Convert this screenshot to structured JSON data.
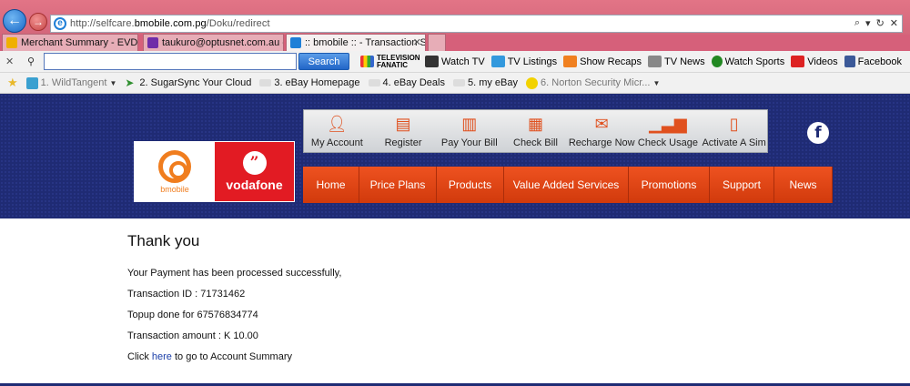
{
  "browser": {
    "url_prefix": "http://selfcare.",
    "url_domain": "bmobile.com.pg",
    "url_path": "/Doku/redirect",
    "tabs": [
      {
        "label": "Merchant Summary - EVD App",
        "favicon_color": "#f0b000"
      },
      {
        "label": "taukuro@optusnet.com.au - ...",
        "favicon_color": "#6f2da8"
      },
      {
        "label": ":: bmobile :: - Transaction S...",
        "favicon_color": "#1f7fd7"
      }
    ],
    "toolbar": {
      "search_placeholder": "",
      "search_button": "Search",
      "items": [
        {
          "label": "",
          "icon": "television-fanatic-logo",
          "color": "#e8b000"
        },
        {
          "label": "Watch TV",
          "icon": "tv-icon",
          "color": "#333333"
        },
        {
          "label": "TV Listings",
          "icon": "tv-listings-icon",
          "color": "#3399dd"
        },
        {
          "label": "Show Recaps",
          "icon": "recaps-icon",
          "color": "#f08020"
        },
        {
          "label": "TV News",
          "icon": "news-icon",
          "color": "#555555"
        },
        {
          "label": "Watch Sports",
          "icon": "sports-icon",
          "color": "#228822"
        },
        {
          "label": "Videos",
          "icon": "youtube-icon",
          "color": "#dd2222"
        },
        {
          "label": "Facebook",
          "icon": "facebook-icon",
          "color": "#3b5998"
        }
      ],
      "tv_fanatic_text": "TELEVISION FANATIC"
    },
    "favorites": [
      {
        "label": "1. WildTangent",
        "icon_color": "#3aa0d0",
        "dim": true,
        "dropdown": true
      },
      {
        "label": "2. SugarSync Your Cloud",
        "icon_color": "#2f8f2f",
        "dim": false
      },
      {
        "label": "3. eBay Homepage",
        "icon_color": "#cccccc",
        "dim": false
      },
      {
        "label": "4. eBay Deals",
        "icon_color": "#cccccc",
        "dim": false
      },
      {
        "label": "5. my eBay",
        "icon_color": "#cccccc",
        "dim": false
      },
      {
        "label": "6. Norton Security Micr...",
        "icon_color": "#f2d200",
        "dim": true,
        "dropdown": true
      }
    ]
  },
  "site": {
    "bmobile_label": "bmobile",
    "vodafone_label": "vodafone",
    "quick_links": [
      {
        "label": "My Account",
        "icon": "user-icon"
      },
      {
        "label": "Register",
        "icon": "register-form-icon"
      },
      {
        "label": "Pay Your Bill",
        "icon": "pay-bill-icon"
      },
      {
        "label": "Check Bill",
        "icon": "check-bill-icon"
      },
      {
        "label": "Recharge Now",
        "icon": "recharge-icon"
      },
      {
        "label": "Check Usage",
        "icon": "usage-chart-icon"
      },
      {
        "label": "Activate A Sim",
        "icon": "sim-card-icon"
      }
    ],
    "nav": [
      "Home",
      "Price Plans",
      "Products",
      "Value Added Services",
      "Promotions",
      "Support",
      "News"
    ],
    "accent_orange": "#e2461a",
    "header_blue": "#1f2b74"
  },
  "content": {
    "title": "Thank you",
    "message": "Your Payment has been processed successfully,",
    "transaction_id": "Transaction ID : 71731462",
    "topup": "Topup done for 67576834774",
    "amount": "Transaction amount : K 10.00",
    "click_prefix": "Click ",
    "link_text": "here",
    "click_suffix": " to go to Account Summary"
  }
}
